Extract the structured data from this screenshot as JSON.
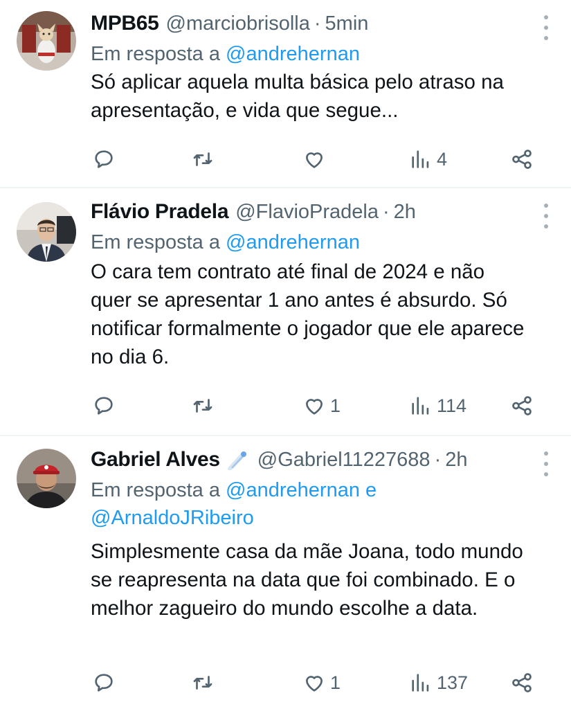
{
  "tweets": [
    {
      "name": "MPB65",
      "handle": "@marciobrisolla",
      "dot": "·",
      "time": "5min",
      "reply_prefix": "Em resposta a",
      "mentions": "@andrehernan",
      "mentions_line2": "",
      "text": "Só aplicar aquela multa básica pelo atraso na apresentação, e vida que segue...",
      "likes": "",
      "views": "4",
      "avatar": "chihuahua-karate-avatar"
    },
    {
      "name": "Flávio Pradela",
      "handle": "@FlavioPradela",
      "dot": "·",
      "time": "2h",
      "reply_prefix": "Em resposta a",
      "mentions": "@andrehernan",
      "mentions_line2": "",
      "text": "O cara tem contrato até final de 2024 e não quer se apresentar 1 ano antes é absurdo. Só notificar formalmente o jogador que ele aparece no dia 6.",
      "likes": "1",
      "views": "114",
      "avatar": "man-in-suit-avatar"
    },
    {
      "name": "Gabriel Alves",
      "handle": "@Gabriel11227688",
      "dot": "·",
      "time": "2h",
      "reply_prefix": "Em resposta a",
      "mentions": "@andrehernan e",
      "mentions_line2": "@ArnaldoJRibeiro",
      "text": "Simplesmente casa da mãe Joana, todo mundo se reapresenta na data que foi combinado. E o melhor zagueiro do mundo escolhe a data.",
      "likes": "1",
      "views": "137",
      "avatar": "man-with-red-cap-avatar",
      "badge": "comet-emoji-icon"
    }
  ],
  "colors": {
    "mention": "#1d9bf0",
    "secondary": "#536471",
    "divider": "#eff3f4"
  },
  "icons": [
    "reply-icon",
    "retweet-icon",
    "like-icon",
    "views-icon",
    "share-icon",
    "more-icon"
  ]
}
